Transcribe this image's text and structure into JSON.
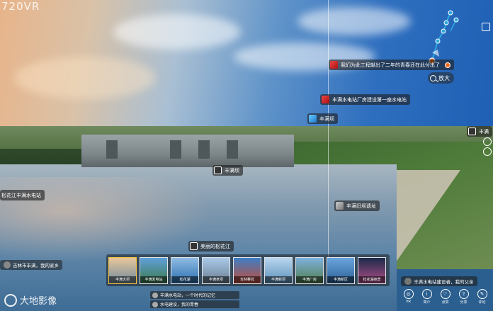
{
  "top_logo": "720VR",
  "map": {
    "zoom_label": "放大"
  },
  "hotspots": [
    {
      "name": "hotspot-poster",
      "label": "我们为此工程献出了二年的青春还在此付出了"
    },
    {
      "name": "hotspot-note",
      "label": "丰满水电站厂房建设第一座水电站"
    },
    {
      "name": "hotspot-scene",
      "label": "丰满坝"
    },
    {
      "name": "hotspot-center",
      "label": "丰满坝"
    },
    {
      "name": "hotspot-right-edge",
      "label": "丰满"
    },
    {
      "name": "hotspot-left-edge",
      "label": "松花江丰满水电站"
    },
    {
      "name": "hotspot-village",
      "label": "丰满旧坝遗址"
    },
    {
      "name": "hotspot-river",
      "label": "美丽的松花江"
    }
  ],
  "messages": {
    "left": "吉林市丰满，我的家乡",
    "right": "丰满水电站建设者，我的父亲"
  },
  "comments": [
    "丰满水电站，一个时代的记忆",
    "水电建设，我的青春"
  ],
  "thumbnails": [
    {
      "caption": "丰满大坝"
    },
    {
      "caption": "丰满发电站"
    },
    {
      "caption": "松花湖"
    },
    {
      "caption": "丰满老坝"
    },
    {
      "caption": "吉林雾凇"
    },
    {
      "caption": "丰满新坝"
    },
    {
      "caption": "丰满厂房"
    },
    {
      "caption": "丰满新区"
    },
    {
      "caption": "松花湖夜景"
    }
  ],
  "brand": "大地影像",
  "toolbar": [
    {
      "icon": "vr-icon",
      "glyph": "◎",
      "label": "VR"
    },
    {
      "icon": "info-icon",
      "glyph": "i",
      "label": "简介"
    },
    {
      "icon": "like-icon",
      "glyph": "♡",
      "label": "点赞"
    },
    {
      "icon": "share-icon",
      "glyph": "⇪",
      "label": "分享"
    },
    {
      "icon": "comment-icon",
      "glyph": "✎",
      "label": "评论"
    }
  ],
  "colors": {
    "accent": "#f5c542",
    "hotspot_dot": "#f26b1d",
    "map_route": "#2ea8e0"
  }
}
